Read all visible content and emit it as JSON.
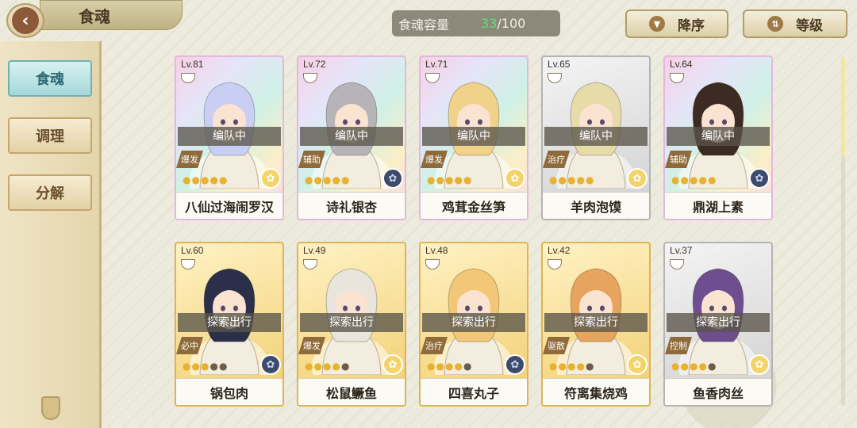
{
  "header": {
    "title": "食魂",
    "capacity_label": "食魂容量",
    "capacity_count": "33",
    "capacity_total": "/100",
    "sort_order_label": "降序",
    "sort_key_label": "等级"
  },
  "sidebar": {
    "items": [
      {
        "label": "食魂",
        "active": true
      },
      {
        "label": "调理",
        "active": false
      },
      {
        "label": "分解",
        "active": false
      }
    ]
  },
  "cards": [
    {
      "level": "Lv.81",
      "status": "编队中",
      "role": "爆发",
      "name": "八仙过海闹罗汉",
      "frame": "rainbow",
      "stars_on": 5,
      "element": "light",
      "hair": "#c8cff2"
    },
    {
      "level": "Lv.72",
      "status": "编队中",
      "role": "辅助",
      "name": "诗礼银杏",
      "frame": "rainbow",
      "stars_on": 5,
      "element": "dark",
      "hair": "#b7b4b8"
    },
    {
      "level": "Lv.71",
      "status": "编队中",
      "role": "爆发",
      "name": "鸡茸金丝笋",
      "frame": "rainbow",
      "stars_on": 5,
      "element": "light",
      "hair": "#f1d28a"
    },
    {
      "level": "Lv.65",
      "status": "编队中",
      "role": "治疗",
      "name": "羊肉泡馍",
      "frame": "silver",
      "stars_on": 5,
      "element": "light",
      "hair": "#e8dbaa"
    },
    {
      "level": "Lv.64",
      "status": "编队中",
      "role": "辅助",
      "name": "鼎湖上素",
      "frame": "rainbow",
      "stars_on": 5,
      "element": "dark",
      "hair": "#3b2b22"
    },
    {
      "level": "Lv.60",
      "status": "探索出行",
      "role": "必中",
      "name": "锅包肉",
      "frame": "gold",
      "stars_on": 3,
      "element": "dark",
      "hair": "#2b2f4a"
    },
    {
      "level": "Lv.49",
      "status": "探索出行",
      "role": "爆发",
      "name": "松鼠鳜鱼",
      "frame": "gold",
      "stars_on": 4,
      "element": "light",
      "hair": "#e9e4dc"
    },
    {
      "level": "Lv.48",
      "status": "探索出行",
      "role": "治疗",
      "name": "四喜丸子",
      "frame": "gold",
      "stars_on": 4,
      "element": "dark",
      "hair": "#f2c778"
    },
    {
      "level": "Lv.42",
      "status": "探索出行",
      "role": "驱散",
      "name": "符离集烧鸡",
      "frame": "gold",
      "stars_on": 4,
      "element": "light",
      "hair": "#e6a45e"
    },
    {
      "level": "Lv.37",
      "status": "探索出行",
      "role": "控制",
      "name": "鱼香肉丝",
      "frame": "silver",
      "stars_on": 4,
      "element": "light",
      "hair": "#6e4e8e"
    }
  ],
  "icons": {
    "back": "chevron-left-icon",
    "sort_order": "triangle-down-icon",
    "sort_key": "sort-arrows-icon",
    "element_dark": "flower-icon",
    "element_light": "flower-icon",
    "bowl": "bowl-icon"
  }
}
